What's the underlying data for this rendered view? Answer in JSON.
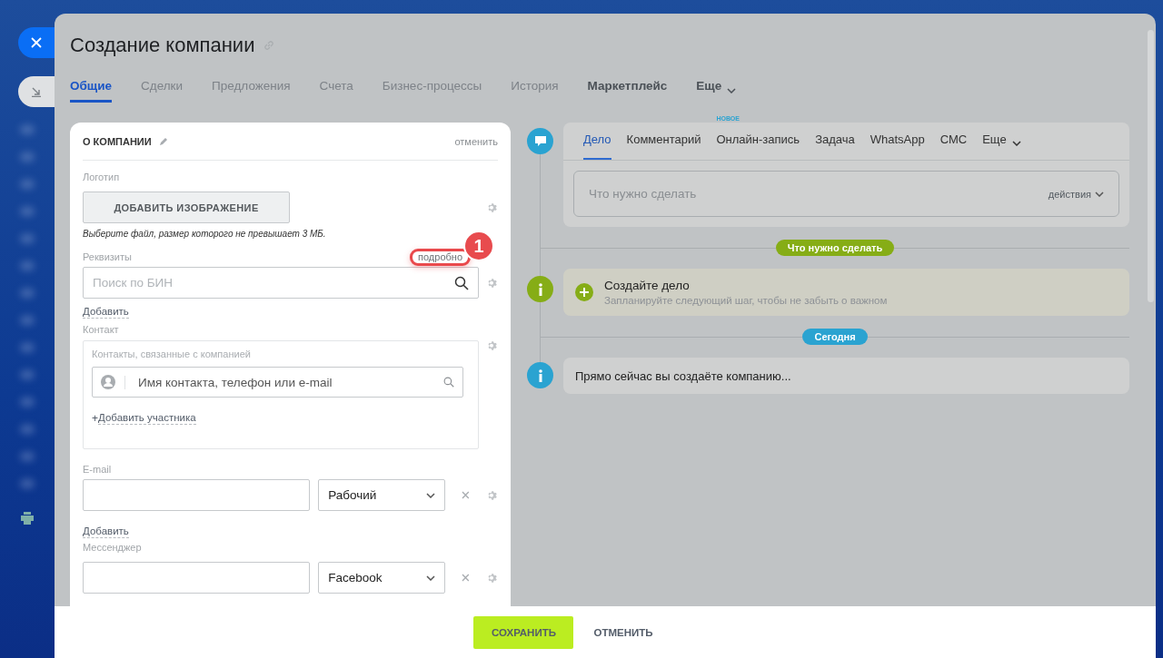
{
  "title": "Создание компании",
  "tabs": [
    {
      "label": "Общие",
      "selected": true,
      "bold": false,
      "menu": false
    },
    {
      "label": "Сделки",
      "selected": false,
      "bold": false,
      "menu": false
    },
    {
      "label": "Предложения",
      "selected": false,
      "bold": false,
      "menu": false
    },
    {
      "label": "Счета",
      "selected": false,
      "bold": false,
      "menu": false
    },
    {
      "label": "Бизнес-процессы",
      "selected": false,
      "bold": false,
      "menu": false
    },
    {
      "label": "История",
      "selected": false,
      "bold": false,
      "menu": false
    },
    {
      "label": "Маркетплейс",
      "selected": false,
      "bold": true,
      "menu": false
    },
    {
      "label": "Еще",
      "selected": false,
      "bold": true,
      "menu": true
    }
  ],
  "company_card": {
    "title": "О КОМПАНИИ",
    "cancel": "отменить",
    "logo_label": "Логотип",
    "add_image": "ДОБАВИТЬ ИЗОБРАЖЕНИЕ",
    "logo_hint": "Выберите файл, размер которого не превышает 3 МБ.",
    "requisites_label": "Реквизиты",
    "requisites_more": "подробно",
    "annotation": "1",
    "bin_placeholder": "Поиск по БИН",
    "requisites_add": "Добавить",
    "contact_label": "Контакт",
    "contact_box_label": "Контакты, связанные с компанией",
    "contact_placeholder": "Имя контакта, телефон или e-mail",
    "add_participant": {
      "icon": "+",
      "label": "Добавить участника"
    },
    "email": {
      "label": "E-mail",
      "type": "Рабочий"
    },
    "email_add": "Добавить",
    "messenger": {
      "label": "Мессенджер",
      "type": "Facebook"
    }
  },
  "timeline": {
    "tabs": [
      {
        "label": "Дело",
        "selected": true,
        "menu": false
      },
      {
        "label": "Комментарий",
        "selected": false,
        "menu": false
      },
      {
        "label": "Онлайн-запись",
        "selected": false,
        "badge": "НОВОЕ",
        "menu": false
      },
      {
        "label": "Задача",
        "selected": false,
        "menu": false
      },
      {
        "label": "WhatsApp",
        "selected": false,
        "menu": false
      },
      {
        "label": "СМС",
        "selected": false,
        "menu": false
      },
      {
        "label": "Еще",
        "selected": false,
        "menu": true
      }
    ],
    "placeholder": "Что нужно сделать",
    "actions": "действия",
    "entries": [
      {
        "kind": "divider",
        "label": "Что нужно сделать",
        "color": "#86ad16"
      },
      {
        "kind": "create",
        "title": "Создайте дело",
        "subtitle": "Запланируйте следующий шаг, чтобы не забыть о важном"
      },
      {
        "kind": "divider",
        "label": "Сегодня",
        "color": "#2aa3d1"
      },
      {
        "kind": "note",
        "text": "Прямо сейчас вы создаёте компанию..."
      }
    ]
  },
  "footer": {
    "save": "СОХРАНИТЬ",
    "cancel": "ОТМЕНИТЬ"
  }
}
